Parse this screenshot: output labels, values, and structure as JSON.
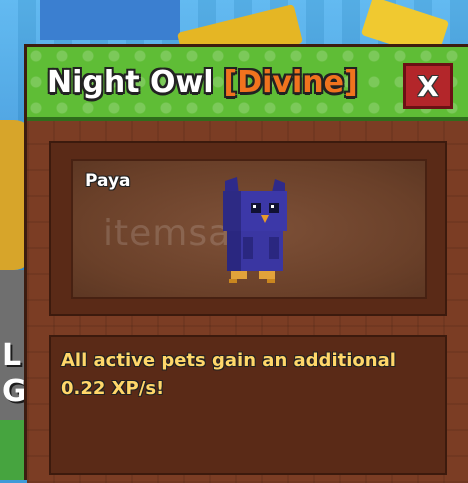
{
  "background": {
    "side_text_1": "L",
    "side_text_2": "G"
  },
  "window": {
    "title": "Night Owl",
    "rarity": "[Divine]",
    "close_label": "X",
    "colors": {
      "titlebar": "#5fbd36",
      "rarity": "#f0731e",
      "close": "#b3262a",
      "panel": "#7b3d24",
      "description_text": "#ffd76a"
    }
  },
  "preview": {
    "pet_name": "Paya",
    "pet_icon": "night-owl-pet",
    "watermark": "itemsatış"
  },
  "description": {
    "line1": "All active pets gain an additional",
    "line2": "0.22 XP/s!"
  }
}
